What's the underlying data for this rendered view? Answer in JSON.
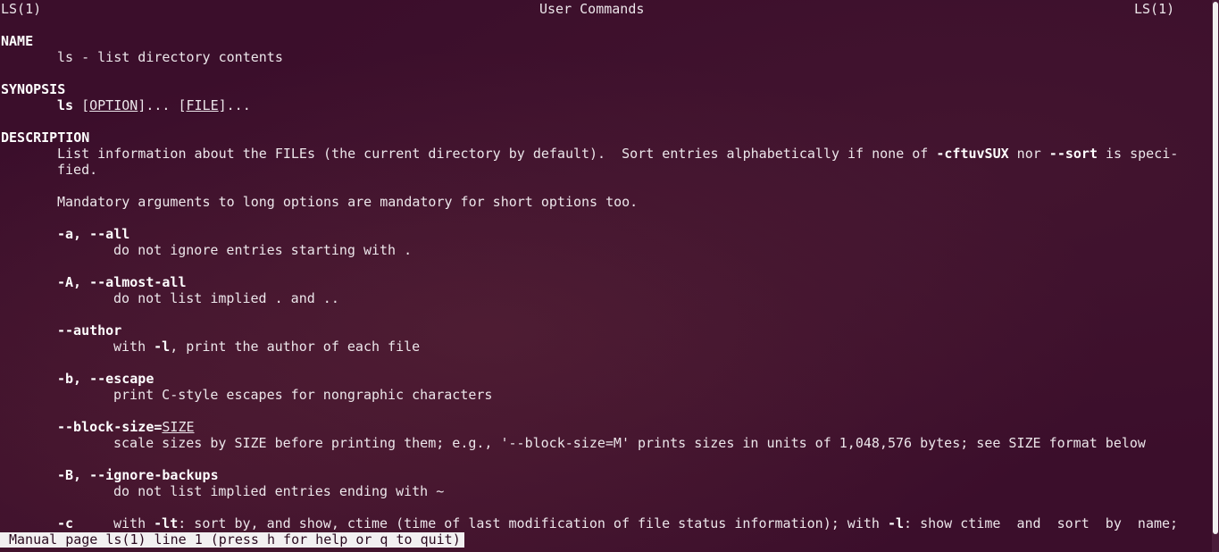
{
  "header": {
    "left": "LS(1)",
    "center": "User Commands",
    "right": "LS(1)"
  },
  "name_section": {
    "heading": "NAME",
    "text": "ls - list directory contents"
  },
  "synopsis": {
    "heading": "SYNOPSIS",
    "cmd": "ls",
    "open1": " [",
    "option": "OPTION",
    "mid": "]... [",
    "file": "FILE",
    "close": "]..."
  },
  "description": {
    "heading": "DESCRIPTION",
    "line1_a": "List information about the FILEs (the current directory by default).  Sort entries alphabetically if none of ",
    "line1_flag1": "-cftuvSUX",
    "line1_b": " nor ",
    "line1_flag2": "--sort",
    "line1_c": " is speci-",
    "line2": "fied.",
    "mandatory": "Mandatory arguments to long options are mandatory for short options too."
  },
  "options": {
    "all_flag": "-a, --all",
    "all_desc": "do not ignore entries starting with .",
    "almost_all_flag": "-A, --almost-all",
    "almost_all_desc": "do not list implied . and ..",
    "author_flag": "--author",
    "author_desc_a": "with ",
    "author_desc_flag": "-l",
    "author_desc_b": ", print the author of each file",
    "escape_flag": "-b, --escape",
    "escape_desc": "print C-style escapes for nongraphic characters",
    "block_size_flag": "--block-size=",
    "block_size_arg": "SIZE",
    "block_size_desc": "scale sizes by SIZE before printing them; e.g., '--block-size=M' prints sizes in units of 1,048,576 bytes; see SIZE format below",
    "ignore_backups_flag": "-B, --ignore-backups",
    "ignore_backups_desc": "do not list implied entries ending with ~",
    "c_flag": "-c",
    "c_desc_a": "with ",
    "c_desc_flag1": "-lt",
    "c_desc_b": ": sort by, and show, ctime (time of last modification of file status information); with ",
    "c_desc_flag2": "-l",
    "c_desc_c": ": show ctime  and  sort  by  name;"
  },
  "status": "Manual page ls(1) line 1 (press h for help or q to quit)"
}
